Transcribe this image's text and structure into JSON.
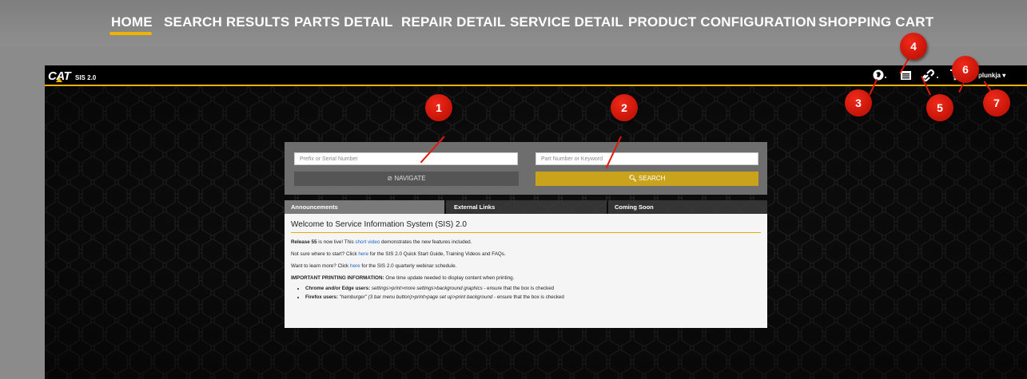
{
  "topnav": {
    "items": [
      "HOME",
      "SEARCH RESULTS",
      "PARTS DETAIL",
      "REPAIR DETAIL",
      "SERVICE DETAIL",
      "PRODUCT CONFIGURATION",
      "SHOPPING CART"
    ],
    "active": "HOME"
  },
  "appbar": {
    "logo": "CAT",
    "product": "SIS 2.0",
    "icons": [
      "globe-icon",
      "list-icon",
      "link-icon",
      "cart-icon"
    ],
    "user": "plunkja"
  },
  "markers": [
    "1",
    "2",
    "3",
    "4",
    "5",
    "6",
    "7"
  ],
  "search": {
    "serial_placeholder": "Prefix or Serial Number",
    "part_placeholder": "Part Number or Keyword",
    "navigate_label": "NAVIGATE",
    "search_label": "SEARCH"
  },
  "tabs": [
    "Announcements",
    "External Links",
    "Coming Soon"
  ],
  "announcements": {
    "title": "Welcome to Service Information System (SIS) 2.0",
    "line1_bold": "Release 55",
    "line1_a": " is now live! This ",
    "line1_link": "short video",
    "line1_b": " demonstrates the new features included.",
    "line2_a": "Not sure where to start? Click ",
    "line2_link": "here",
    "line2_b": " for the SIS 2.0 Quick Start Guide, Training Videos and FAQs.",
    "line3_a": "Want to learn more? Click ",
    "line3_link": "here",
    "line3_b": " for the SIS 2.0 quarterly webinar schedule.",
    "line4_bold": "IMPORTANT PRINTING INFORMATION:",
    "line4_b": " One time update needed to display content when printing.",
    "bullet1_bold": "Chrome and/or Edge users:",
    "bullet1_italic": " settings>print>more settings>background graphics",
    "bullet1_rest": " - ensure that the box is checked",
    "bullet2_bold": "Firefox users:",
    "bullet2_italic": " \"hamburger\" (3 bar menu button)>print>page set up>print background",
    "bullet2_rest": " - ensure that the box is checked"
  },
  "colors": {
    "accent": "#f0b400",
    "marker": "#d81e10",
    "search": "#c9a31c"
  }
}
